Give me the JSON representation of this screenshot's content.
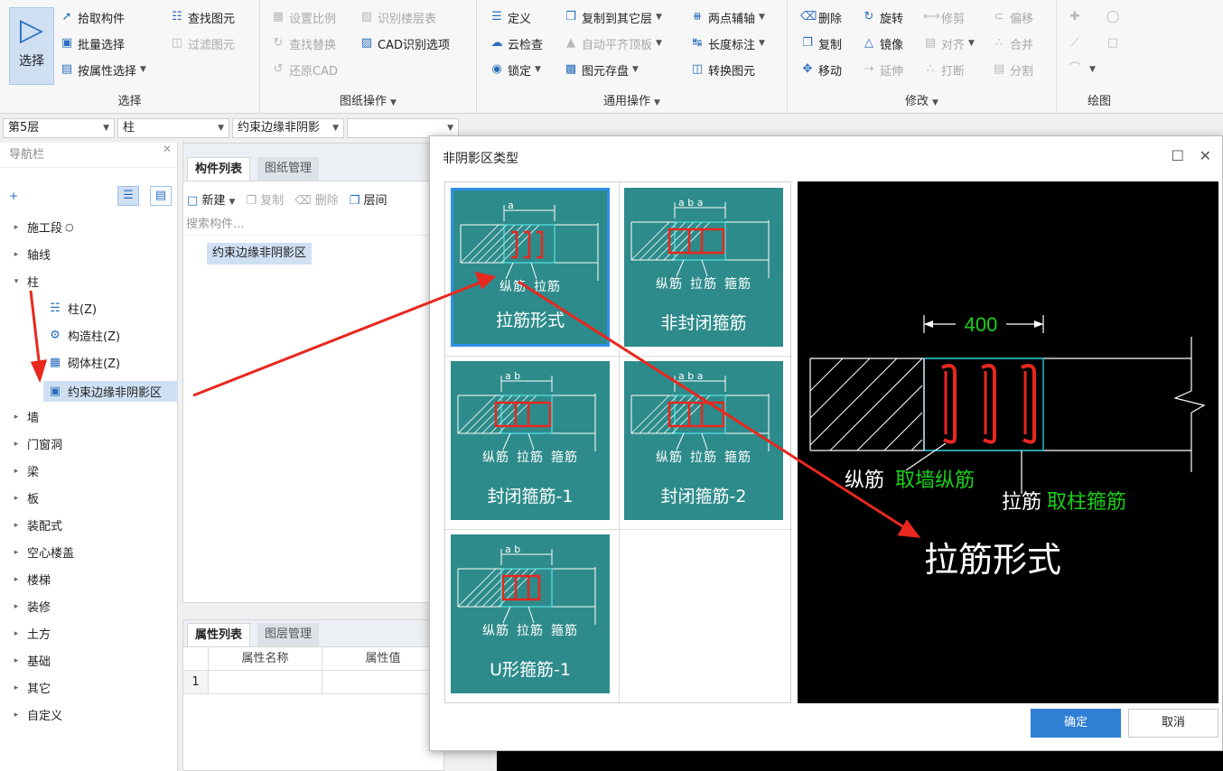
{
  "ribbon": {
    "select_big": "选择",
    "pick": "拾取构件",
    "batch_select": "批量选择",
    "attr_select": "按属性选择",
    "find_elem": "查找图元",
    "filter_elem": "过滤图元",
    "group_select": "选择",
    "set_ratio": "设置比例",
    "identify_floor": "识别楼层表",
    "find_replace": "查找替换",
    "cad_options": "CAD识别选项",
    "restore_cad": "还原CAD",
    "group_drawing": "图纸操作",
    "define": "定义",
    "copy_to_floor": "复制到其它层",
    "two_point_axis": "两点辅轴",
    "cloud_check": "云检查",
    "auto_flush": "自动平齐顶板",
    "length_mark": "长度标注",
    "lock": "锁定",
    "elem_save": "图元存盘",
    "convert_elem": "转换图元",
    "group_general": "通用操作",
    "delete": "删除",
    "rotate": "旋转",
    "trim": "修剪",
    "offset": "偏移",
    "copy": "复制",
    "mirror": "镜像",
    "align": "对齐",
    "merge": "合并",
    "move": "移动",
    "extend": "延伸",
    "break": "打断",
    "split": "分割",
    "group_modify": "修改",
    "group_draw": "绘图"
  },
  "combos": {
    "floor": "第5层",
    "type": "柱",
    "sub": "约束边缘非阴影",
    "empty": ""
  },
  "nav": {
    "title": "导航栏",
    "items": [
      {
        "label": "施工段",
        "level": 0,
        "arrow": "▸",
        "icon": ""
      },
      {
        "label": "轴线",
        "level": 0,
        "arrow": "▸",
        "icon": ""
      },
      {
        "label": "柱",
        "level": 0,
        "arrow": "▾",
        "icon": ""
      },
      {
        "label": "柱(Z)",
        "level": 1,
        "arrow": "",
        "icon": "column-icon"
      },
      {
        "label": "构造柱(Z)",
        "level": 1,
        "arrow": "",
        "icon": "construct-column-icon"
      },
      {
        "label": "砌体柱(Z)",
        "level": 1,
        "arrow": "",
        "icon": "masonry-column-icon"
      },
      {
        "label": "约束边缘非阴影区",
        "level": 1,
        "arrow": "",
        "icon": "edge-zone-icon"
      },
      {
        "label": "墙",
        "level": 0,
        "arrow": "▸",
        "icon": ""
      },
      {
        "label": "门窗洞",
        "level": 0,
        "arrow": "▸",
        "icon": ""
      },
      {
        "label": "梁",
        "level": 0,
        "arrow": "▸",
        "icon": ""
      },
      {
        "label": "板",
        "level": 0,
        "arrow": "▸",
        "icon": ""
      },
      {
        "label": "装配式",
        "level": 0,
        "arrow": "▸",
        "icon": ""
      },
      {
        "label": "空心楼盖",
        "level": 0,
        "arrow": "▸",
        "icon": ""
      },
      {
        "label": "楼梯",
        "level": 0,
        "arrow": "▸",
        "icon": ""
      },
      {
        "label": "装修",
        "level": 0,
        "arrow": "▸",
        "icon": ""
      },
      {
        "label": "土方",
        "level": 0,
        "arrow": "▸",
        "icon": ""
      },
      {
        "label": "基础",
        "level": 0,
        "arrow": "▸",
        "icon": ""
      },
      {
        "label": "其它",
        "level": 0,
        "arrow": "▸",
        "icon": ""
      },
      {
        "label": "自定义",
        "level": 0,
        "arrow": "▸",
        "icon": ""
      }
    ]
  },
  "complist": {
    "tab_active": "构件列表",
    "tab_inactive": "图纸管理",
    "new": "新建",
    "copy": "复制",
    "delete": "删除",
    "layer": "层间",
    "search_placeholder": "搜索构件...",
    "item": "约束边缘非阴影区"
  },
  "attrlist": {
    "tab_active": "属性列表",
    "tab_inactive": "图层管理",
    "col_name": "属性名称",
    "col_value": "属性值",
    "row1": "1"
  },
  "dialog": {
    "title": "非阴影区类型",
    "ok": "确定",
    "cancel": "取消",
    "thumbs": [
      {
        "label": "拉筋形式",
        "dims": "a",
        "notes": [
          "纵筋",
          "拉筋"
        ]
      },
      {
        "label": "非封闭箍筋",
        "dims": "a b a",
        "notes": [
          "纵筋",
          "拉筋",
          "箍筋"
        ]
      },
      {
        "label": "封闭箍筋-1",
        "dims": "a b",
        "notes": [
          "纵筋",
          "拉筋",
          "箍筋"
        ]
      },
      {
        "label": "封闭箍筋-2",
        "dims": "a b a",
        "notes": [
          "纵筋",
          "拉筋",
          "箍筋"
        ]
      },
      {
        "label": "U形箍筋-1",
        "dims": "a b",
        "notes": [
          "纵筋",
          "拉筋",
          "箍筋"
        ]
      }
    ],
    "preview": {
      "dimension": "400",
      "long_bar": "纵筋",
      "long_bar_note": "取墙纵筋",
      "tie": "拉筋",
      "tie_note": "取柱箍筋",
      "title": "拉筋形式"
    }
  },
  "colors": {
    "accent": "#2f7fd4",
    "thumb_bg": "#2e8b8b",
    "arrow_red": "#e8281e",
    "cad_green": "#19d219"
  }
}
